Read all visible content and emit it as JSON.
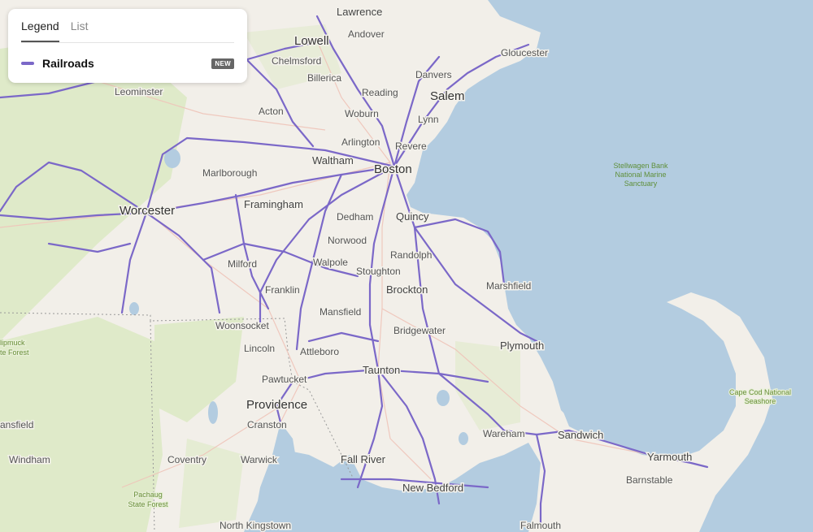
{
  "legend_panel": {
    "tabs": [
      {
        "label": "Legend",
        "active": true
      },
      {
        "label": "List",
        "active": false
      }
    ],
    "layers": [
      {
        "label": "Railroads",
        "badge": "NEW",
        "color": "#7b68c8"
      }
    ]
  },
  "map": {
    "colors": {
      "water": "#b3cce0",
      "land": "#f2efe9",
      "forest": "#dce8c4",
      "railroad": "#7b68c8",
      "road": "#f2c9c0"
    },
    "places": [
      {
        "name": "Lawrence"
      },
      {
        "name": "Andover"
      },
      {
        "name": "Lowell"
      },
      {
        "name": "Chelmsford"
      },
      {
        "name": "Billerica"
      },
      {
        "name": "Gloucester"
      },
      {
        "name": "Danvers"
      },
      {
        "name": "Salem"
      },
      {
        "name": "Reading"
      },
      {
        "name": "Leominster"
      },
      {
        "name": "Woburn"
      },
      {
        "name": "Acton"
      },
      {
        "name": "Lynn"
      },
      {
        "name": "Arlington"
      },
      {
        "name": "Revere"
      },
      {
        "name": "Waltham"
      },
      {
        "name": "Boston"
      },
      {
        "name": "Marlborough"
      },
      {
        "name": "Framingham"
      },
      {
        "name": "Worcester"
      },
      {
        "name": "Dedham"
      },
      {
        "name": "Quincy"
      },
      {
        "name": "Norwood"
      },
      {
        "name": "Randolph"
      },
      {
        "name": "Milford"
      },
      {
        "name": "Walpole"
      },
      {
        "name": "Stoughton"
      },
      {
        "name": "Franklin"
      },
      {
        "name": "Brockton"
      },
      {
        "name": "Marshfield"
      },
      {
        "name": "Mansfield"
      },
      {
        "name": "Woonsocket"
      },
      {
        "name": "Bridgewater"
      },
      {
        "name": "Lincoln"
      },
      {
        "name": "Attleboro"
      },
      {
        "name": "Plymouth"
      },
      {
        "name": "Taunton"
      },
      {
        "name": "Pawtucket"
      },
      {
        "name": "Providence"
      },
      {
        "name": "Cranston"
      },
      {
        "name": "Wareham"
      },
      {
        "name": "Sandwich"
      },
      {
        "name": "ansfield"
      },
      {
        "name": "Windham"
      },
      {
        "name": "Coventry"
      },
      {
        "name": "Warwick"
      },
      {
        "name": "Fall River"
      },
      {
        "name": "New Bedford"
      },
      {
        "name": "Yarmouth"
      },
      {
        "name": "Barnstable"
      },
      {
        "name": "North Kingstown"
      },
      {
        "name": "Falmouth"
      }
    ],
    "parks": [
      {
        "lines": [
          "Stellwagen Bank",
          "National Marine",
          "Sanctuary"
        ]
      },
      {
        "lines": [
          "Cape Cod National",
          "Seashore"
        ]
      },
      {
        "lines": [
          "lipmuck",
          "te Forest"
        ]
      },
      {
        "lines": [
          "Pachaug",
          "State Forest"
        ]
      }
    ]
  }
}
